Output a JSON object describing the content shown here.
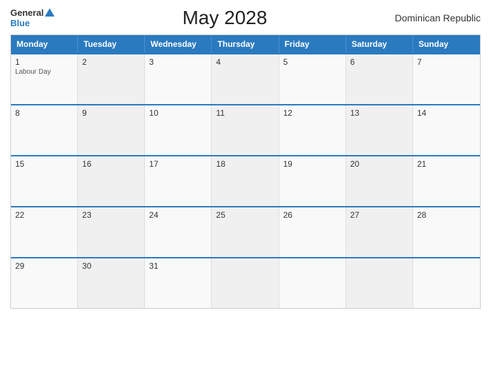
{
  "header": {
    "logo_general": "General",
    "logo_blue": "Blue",
    "title": "May 2028",
    "country": "Dominican Republic"
  },
  "weekdays": [
    "Monday",
    "Tuesday",
    "Wednesday",
    "Thursday",
    "Friday",
    "Saturday",
    "Sunday"
  ],
  "weeks": [
    [
      {
        "day": "1",
        "event": "Labour Day"
      },
      {
        "day": "2",
        "event": ""
      },
      {
        "day": "3",
        "event": ""
      },
      {
        "day": "4",
        "event": ""
      },
      {
        "day": "5",
        "event": ""
      },
      {
        "day": "6",
        "event": ""
      },
      {
        "day": "7",
        "event": ""
      }
    ],
    [
      {
        "day": "8",
        "event": ""
      },
      {
        "day": "9",
        "event": ""
      },
      {
        "day": "10",
        "event": ""
      },
      {
        "day": "11",
        "event": ""
      },
      {
        "day": "12",
        "event": ""
      },
      {
        "day": "13",
        "event": ""
      },
      {
        "day": "14",
        "event": ""
      }
    ],
    [
      {
        "day": "15",
        "event": ""
      },
      {
        "day": "16",
        "event": ""
      },
      {
        "day": "17",
        "event": ""
      },
      {
        "day": "18",
        "event": ""
      },
      {
        "day": "19",
        "event": ""
      },
      {
        "day": "20",
        "event": ""
      },
      {
        "day": "21",
        "event": ""
      }
    ],
    [
      {
        "day": "22",
        "event": ""
      },
      {
        "day": "23",
        "event": ""
      },
      {
        "day": "24",
        "event": ""
      },
      {
        "day": "25",
        "event": ""
      },
      {
        "day": "26",
        "event": ""
      },
      {
        "day": "27",
        "event": ""
      },
      {
        "day": "28",
        "event": ""
      }
    ],
    [
      {
        "day": "29",
        "event": ""
      },
      {
        "day": "30",
        "event": ""
      },
      {
        "day": "31",
        "event": ""
      },
      {
        "day": "",
        "event": ""
      },
      {
        "day": "",
        "event": ""
      },
      {
        "day": "",
        "event": ""
      },
      {
        "day": "",
        "event": ""
      }
    ]
  ]
}
